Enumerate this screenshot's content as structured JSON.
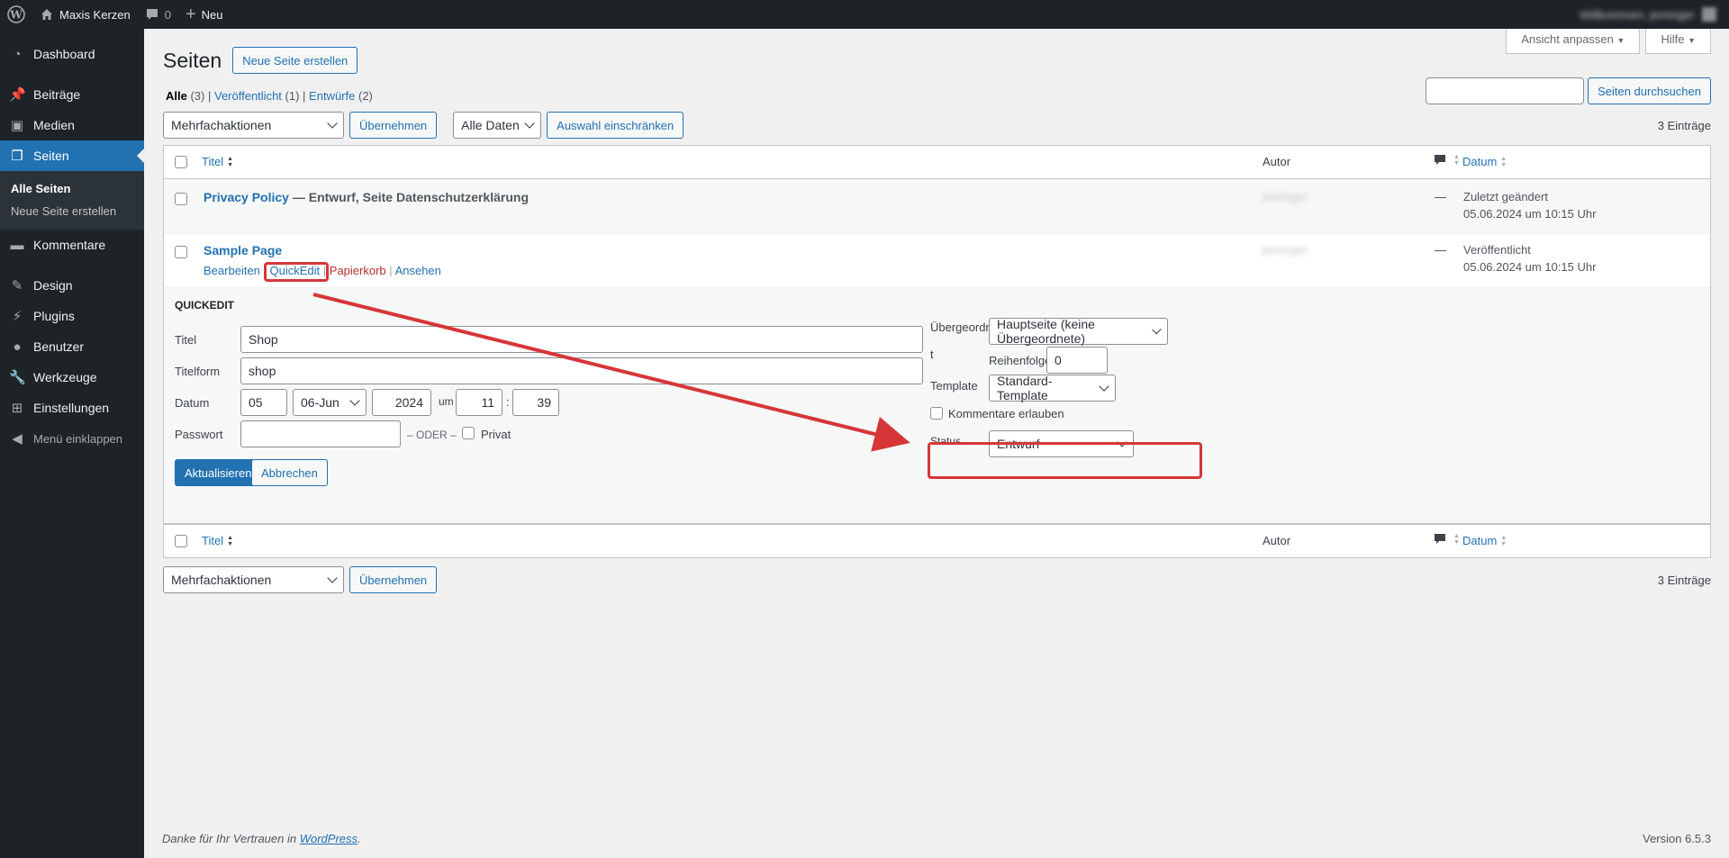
{
  "adminbar": {
    "site_name": "Maxis Kerzen",
    "comments_count": "0",
    "new_label": "Neu",
    "greeting": "Willkommen, jeminger"
  },
  "menu": {
    "items": [
      {
        "label": "Dashboard",
        "icon": "dashboard-icon"
      },
      {
        "label": "Beiträge",
        "icon": "pushpin-icon"
      },
      {
        "label": "Medien",
        "icon": "media-icon"
      },
      {
        "label": "Seiten",
        "icon": "pages-icon"
      },
      {
        "label": "Kommentare",
        "icon": "comment-icon"
      },
      {
        "label": "Design",
        "icon": "paintbrush-icon"
      },
      {
        "label": "Plugins",
        "icon": "plugin-icon"
      },
      {
        "label": "Benutzer",
        "icon": "user-icon"
      },
      {
        "label": "Werkzeuge",
        "icon": "wrench-icon"
      },
      {
        "label": "Einstellungen",
        "icon": "settings-icon"
      }
    ],
    "submenu": [
      "Alle Seiten",
      "Neue Seite erstellen"
    ],
    "collapse": "Menü einklappen"
  },
  "screen_meta": {
    "options": "Ansicht anpassen",
    "help": "Hilfe"
  },
  "page": {
    "title": "Seiten",
    "add_new": "Neue Seite erstellen",
    "views": {
      "all": "Alle",
      "all_count": "(3)",
      "published": "Veröffentlicht",
      "published_count": "(1)",
      "drafts": "Entwürfe",
      "drafts_count": "(2)"
    },
    "search_button": "Seiten durchsuchen"
  },
  "tablenav": {
    "bulk_actions": "Mehrfachaktionen",
    "apply": "Übernehmen",
    "all_dates": "Alle Daten",
    "filter": "Auswahl einschränken",
    "items_count": "3 Einträge"
  },
  "table": {
    "columns": {
      "title": "Titel",
      "author": "Autor",
      "date": "Datum"
    },
    "rows": [
      {
        "title": "Privacy Policy",
        "state": " — Entwurf, Seite Datenschutzerklärung",
        "author": "jeminger",
        "comments": "—",
        "date_status": "Zuletzt geändert",
        "date_value": "05.06.2024 um 10:15 Uhr"
      },
      {
        "title": "Sample Page",
        "author": "jeminger",
        "comments": "—",
        "date_status": "Veröffentlicht",
        "date_value": "05.06.2024 um 10:15 Uhr",
        "actions": {
          "edit": "Bearbeiten",
          "quickedit": "QuickEdit",
          "trash": "Papierkorb",
          "view": "Ansehen"
        }
      }
    ]
  },
  "quickedit": {
    "legend": "QUICKEDIT",
    "title_label": "Titel",
    "title_value": "Shop",
    "slug_label": "Titelform",
    "slug_value": "shop",
    "date_label": "Datum",
    "day": "05",
    "month": "06-Jun",
    "year": "2024",
    "at": "um",
    "hour": "11",
    "colon": ":",
    "minute": "39",
    "password_label": "Passwort",
    "or": "– ODER –",
    "private_label": "Privat",
    "parent_label_1": "Übergeordne",
    "parent_label_2": "t",
    "parent_value": "Hauptseite (keine Übergeordnete)",
    "order_label": "Reihenfolge",
    "order_value": "0",
    "template_label": "Template",
    "template_value": "Standard-Template",
    "comments_label": "Kommentare erlauben",
    "status_label": "Status",
    "status_value": "Entwurf",
    "update_button": "Aktualisieren",
    "cancel_button": "Abbrechen"
  },
  "footer": {
    "thanks_prefix": "Danke für Ihr Vertrauen in ",
    "thanks_link": "WordPress",
    "thanks_suffix": ".",
    "version": "Version 6.5.3"
  },
  "annotation_color": "#d63638"
}
